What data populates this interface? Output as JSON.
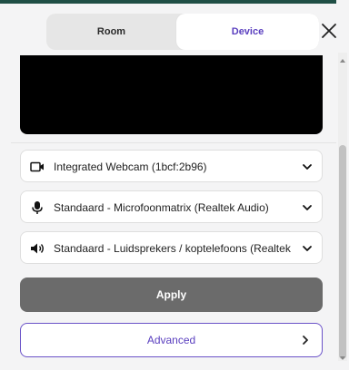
{
  "tabs": {
    "room": "Room",
    "device": "Device"
  },
  "devices": {
    "camera": "Integrated Webcam (1bcf:2b96)",
    "microphone": "Standaard - Microfoonmatrix (Realtek Audio)",
    "speaker": "Standaard - Luidsprekers / koptelefoons (Realtek Audio)"
  },
  "actions": {
    "apply": "Apply",
    "advanced": "Advanced"
  },
  "icons": {
    "close": "close-icon",
    "camera": "video-camera-icon",
    "microphone": "microphone-icon",
    "speaker": "speaker-icon",
    "chevron": "chevron-down-icon",
    "arrow": "chevron-right-icon"
  },
  "colors": {
    "accent": "#5a3fbf",
    "apply_bg": "#6b6b6b",
    "header": "#1f4f45"
  }
}
